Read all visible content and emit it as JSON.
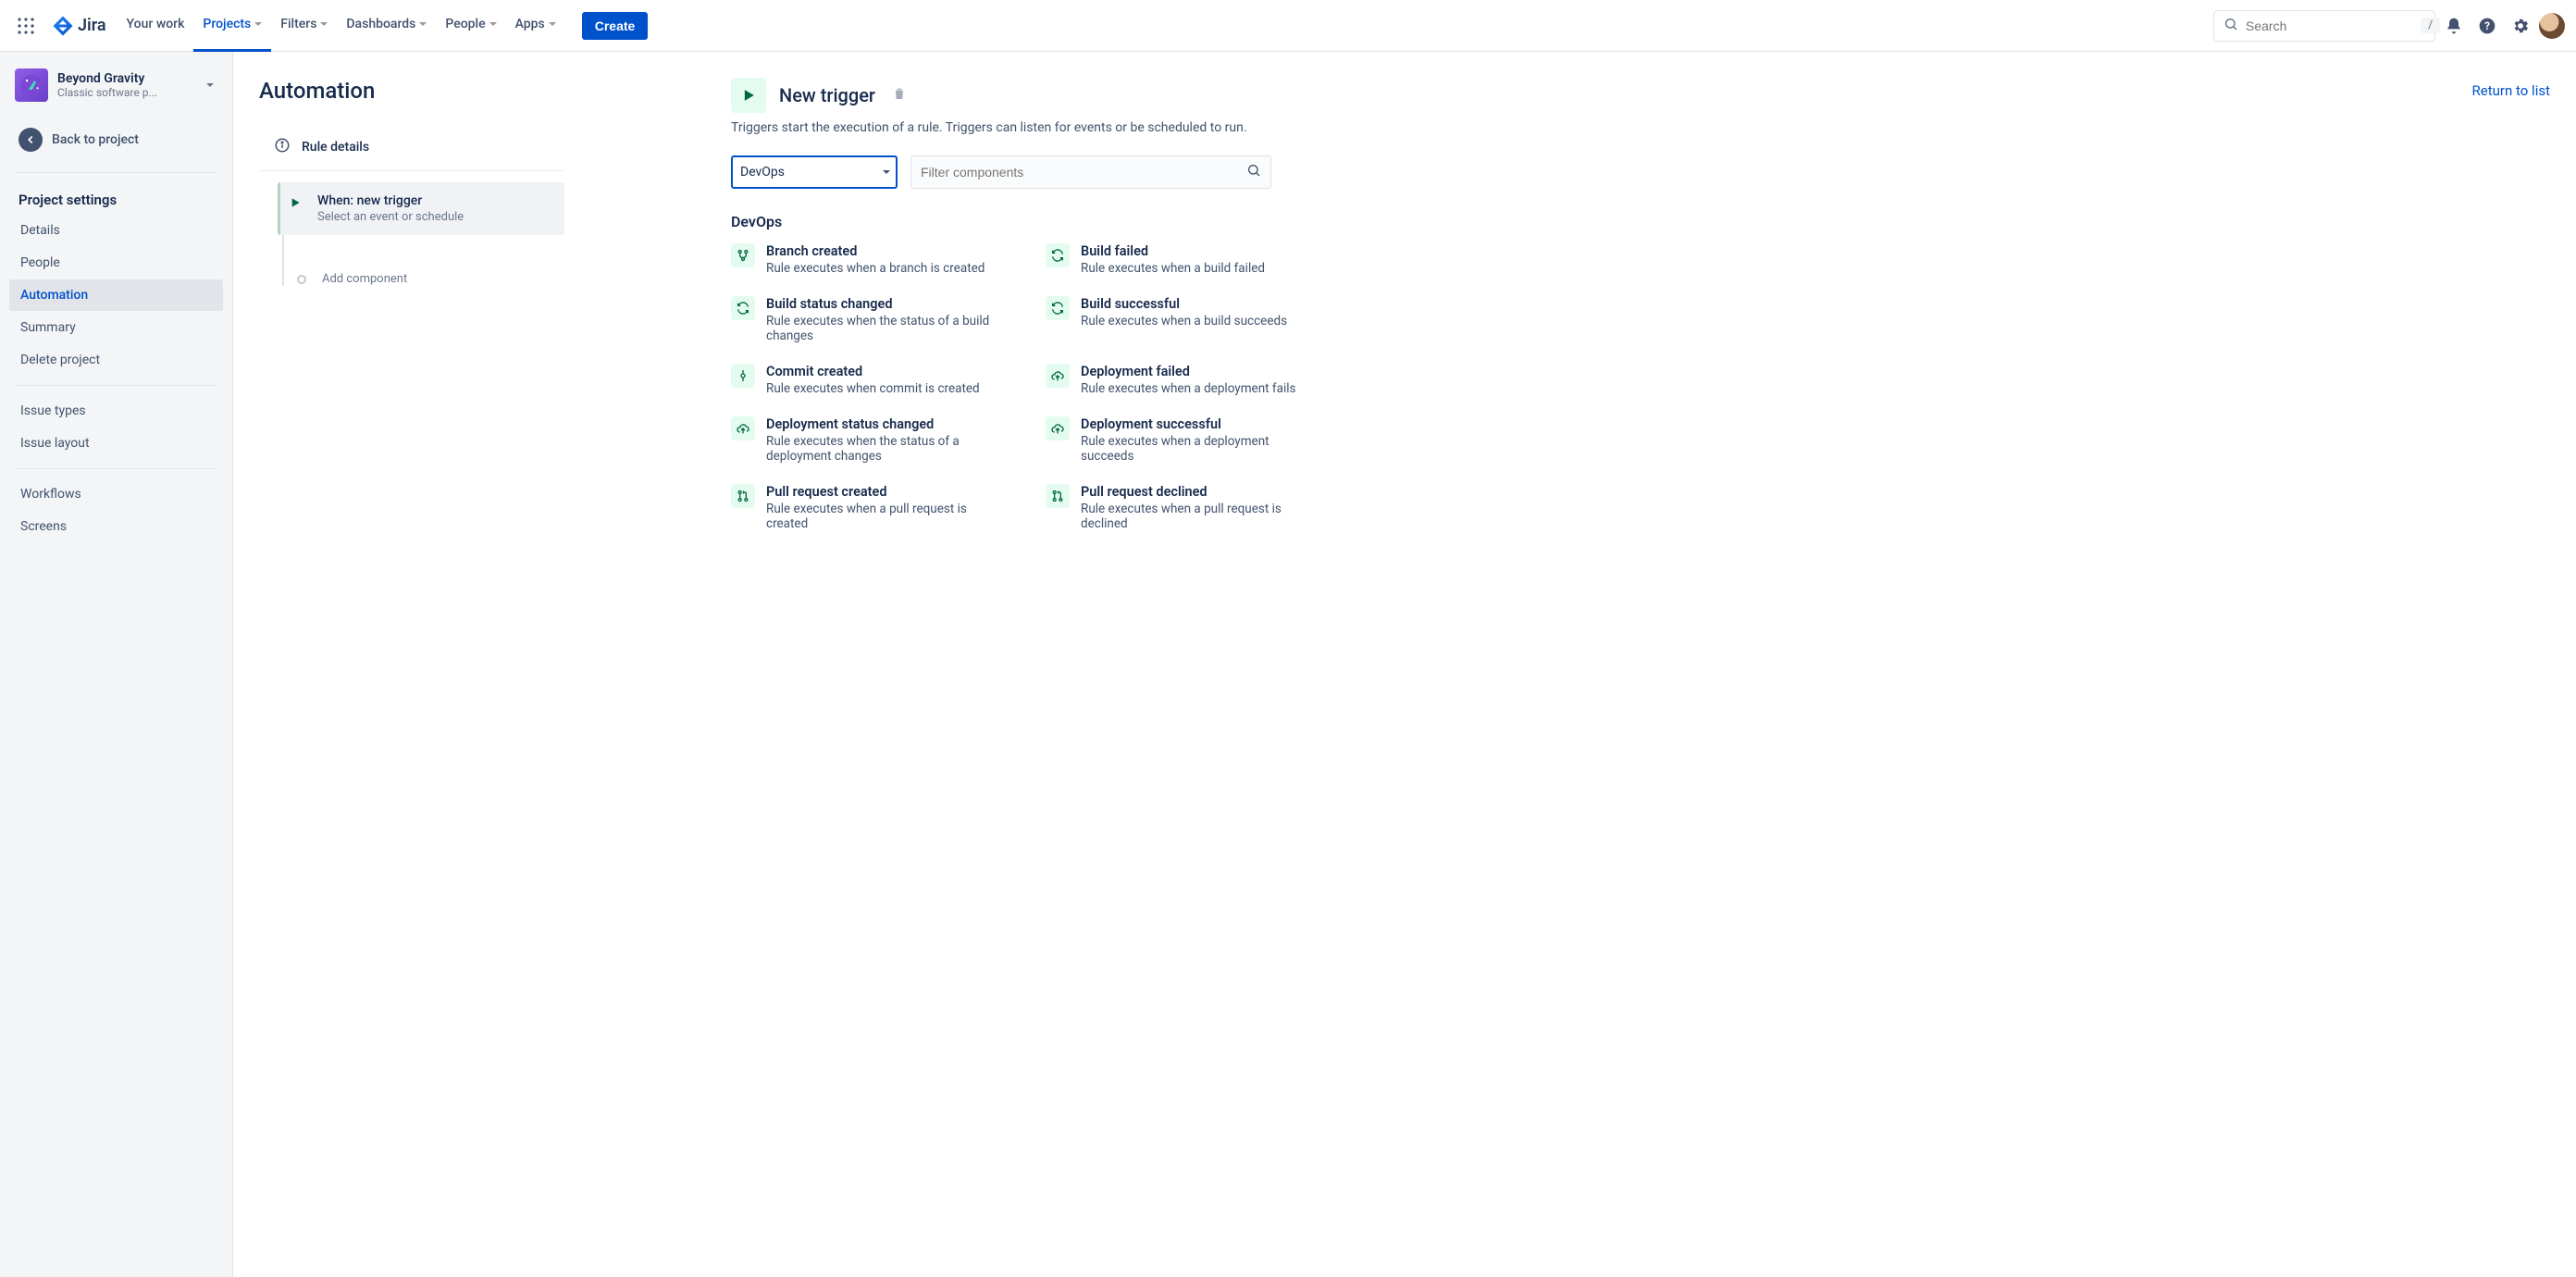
{
  "topnav": {
    "product": "Jira",
    "items": [
      {
        "label": "Your work",
        "active": false,
        "hasMenu": false
      },
      {
        "label": "Projects",
        "active": true,
        "hasMenu": true
      },
      {
        "label": "Filters",
        "active": false,
        "hasMenu": true
      },
      {
        "label": "Dashboards",
        "active": false,
        "hasMenu": true
      },
      {
        "label": "People",
        "active": false,
        "hasMenu": true
      },
      {
        "label": "Apps",
        "active": false,
        "hasMenu": true
      }
    ],
    "create_label": "Create",
    "search_placeholder": "Search",
    "search_shortcut": "/"
  },
  "sidebar": {
    "project_name": "Beyond Gravity",
    "project_type": "Classic software p...",
    "back_label": "Back to project",
    "settings_heading": "Project settings",
    "items": [
      {
        "label": "Details",
        "active": false
      },
      {
        "label": "People",
        "active": false
      },
      {
        "label": "Automation",
        "active": true
      },
      {
        "label": "Summary",
        "active": false
      },
      {
        "label": "Delete project",
        "active": false
      }
    ],
    "items2": [
      {
        "label": "Issue types"
      },
      {
        "label": "Issue layout"
      }
    ],
    "items3": [
      {
        "label": "Workflows"
      },
      {
        "label": "Screens"
      }
    ]
  },
  "page": {
    "title": "Automation",
    "return_link": "Return to list",
    "rule_details_label": "Rule details",
    "step_title": "When: new trigger",
    "step_sub": "Select an event or schedule",
    "add_component": "Add component"
  },
  "config": {
    "title": "New trigger",
    "description": "Triggers start the execution of a rule. Triggers can listen for events or be scheduled to run.",
    "category_value": "DevOps",
    "filter_placeholder": "Filter components",
    "section_heading": "DevOps",
    "triggers": [
      {
        "icon": "branch",
        "title": "Branch created",
        "desc": "Rule executes when a branch is created"
      },
      {
        "icon": "sync",
        "title": "Build failed",
        "desc": "Rule executes when a build failed"
      },
      {
        "icon": "sync",
        "title": "Build status changed",
        "desc": "Rule executes when the status of a build changes"
      },
      {
        "icon": "sync",
        "title": "Build successful",
        "desc": "Rule executes when a build succeeds"
      },
      {
        "icon": "commit",
        "title": "Commit created",
        "desc": "Rule executes when commit is created"
      },
      {
        "icon": "cloud",
        "title": "Deployment failed",
        "desc": "Rule executes when a deployment fails"
      },
      {
        "icon": "cloud",
        "title": "Deployment status changed",
        "desc": "Rule executes when the status of a deployment changes"
      },
      {
        "icon": "cloud",
        "title": "Deployment successful",
        "desc": "Rule executes when a deployment succeeds"
      },
      {
        "icon": "pr",
        "title": "Pull request created",
        "desc": "Rule executes when a pull request is created"
      },
      {
        "icon": "pr",
        "title": "Pull request declined",
        "desc": "Rule executes when a pull request is declined"
      }
    ]
  }
}
